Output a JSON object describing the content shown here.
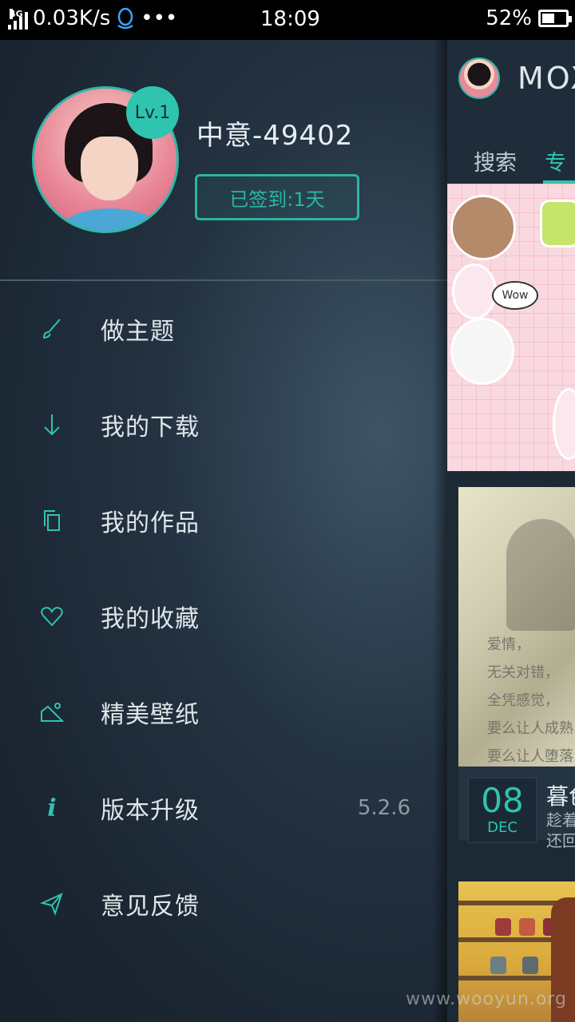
{
  "status_bar": {
    "network_type": "4G",
    "speed": "0.03K/s",
    "more": "•••",
    "time": "18:09",
    "battery_percent": "52%",
    "battery_level": 0.52
  },
  "profile": {
    "level": "Lv.1",
    "username": "中意-49402",
    "checkin_label": "已签到:1天"
  },
  "menu": {
    "items": [
      {
        "label": "做主题",
        "icon": "brush-icon"
      },
      {
        "label": "我的下载",
        "icon": "download-arrow-icon"
      },
      {
        "label": "我的作品",
        "icon": "copy-icon"
      },
      {
        "label": "我的收藏",
        "icon": "heart-icon"
      },
      {
        "label": "精美壁纸",
        "icon": "wallpaper-icon"
      },
      {
        "label": "版本升级",
        "icon": "info-icon",
        "extra": "5.2.6"
      },
      {
        "label": "意见反馈",
        "icon": "send-icon"
      }
    ]
  },
  "main": {
    "brand": "MOX",
    "tab_search": "搜索",
    "tab_next": "专",
    "card2": {
      "overlay_lines": [
        "爱情，",
        "无关对错，",
        "全凭感觉，",
        "要么让人成熟",
        "要么让人堕落"
      ],
      "date_day": "08",
      "date_month": "DEC",
      "title": "暮色",
      "subtitle_line1": "趁着",
      "subtitle_line2": "还回"
    },
    "sticker_text": "Wow"
  },
  "watermark": "www.wooyun.org",
  "colors": {
    "accent": "#2ec4b0",
    "drawer_bg": "#1f2c38",
    "text_primary": "#dfe6ea",
    "text_secondary": "#8f9ba3"
  }
}
